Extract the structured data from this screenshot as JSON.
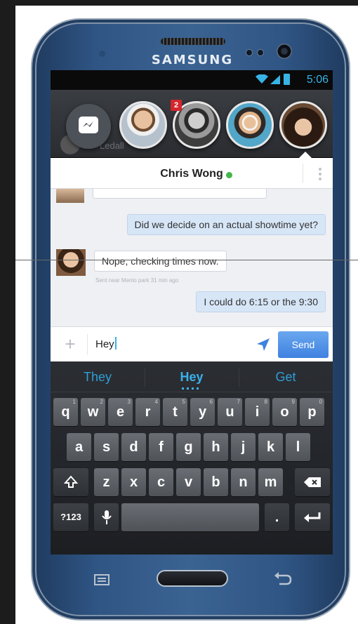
{
  "device": {
    "brand": "SAMSUNG"
  },
  "status_bar": {
    "time": "5:06",
    "icons": [
      "wifi-icon",
      "signal-icon",
      "battery-icon"
    ],
    "accent_color": "#37b3e6"
  },
  "background_thread": {
    "ghost_name": "Ledall"
  },
  "chat_heads": [
    {
      "name": "messenger-head",
      "icon": "messenger-icon"
    },
    {
      "name": "chathead-1",
      "badge": ""
    },
    {
      "name": "chathead-2",
      "badge": "2"
    },
    {
      "name": "chathead-3",
      "badge": ""
    },
    {
      "name": "chathead-4",
      "badge": "",
      "active": true
    }
  ],
  "chat": {
    "title": "Chris Wong",
    "online": true,
    "online_color": "#45b649",
    "messages": [
      {
        "direction": "out",
        "text": "Did we decide on an actual showtime yet?"
      },
      {
        "direction": "in",
        "text": "Nope, checking times now.",
        "meta": "Sent near Menlo park 31 min ago"
      },
      {
        "direction": "out",
        "text": "I could do 6:15 or the 9:30"
      }
    ]
  },
  "composer": {
    "value": "Hey",
    "send_label": "Send",
    "send_color": "#4a8ee6"
  },
  "keyboard": {
    "suggestions": [
      "They",
      "Hey",
      "Get"
    ],
    "row1": [
      {
        "k": "q",
        "n": "1"
      },
      {
        "k": "w",
        "n": "2"
      },
      {
        "k": "e",
        "n": "3"
      },
      {
        "k": "r",
        "n": "4"
      },
      {
        "k": "t",
        "n": "5"
      },
      {
        "k": "y",
        "n": "6"
      },
      {
        "k": "u",
        "n": "7"
      },
      {
        "k": "i",
        "n": "8"
      },
      {
        "k": "o",
        "n": "9"
      },
      {
        "k": "p",
        "n": "0"
      }
    ],
    "row2": [
      "a",
      "s",
      "d",
      "f",
      "g",
      "h",
      "j",
      "k",
      "l"
    ],
    "row3": [
      "z",
      "x",
      "c",
      "v",
      "b",
      "n",
      "m"
    ],
    "symbols_label": "?123",
    "period_label": "."
  }
}
